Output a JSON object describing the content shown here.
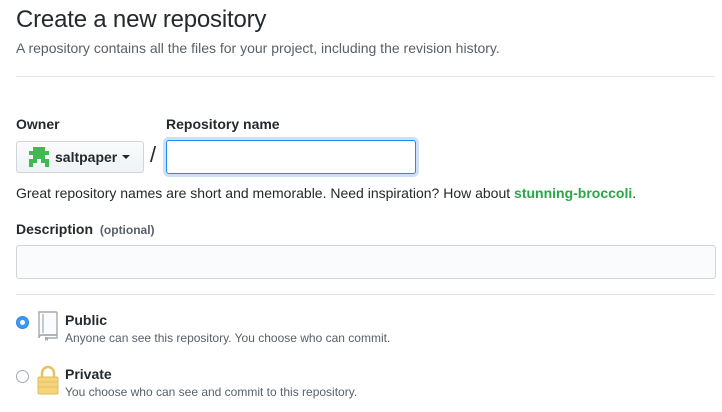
{
  "page": {
    "title": "Create a new repository",
    "subtitle": "A repository contains all the files for your project, including the revision history."
  },
  "owner": {
    "label": "Owner",
    "value": "saltpaper",
    "avatar_icon": "identicon-avatar",
    "avatar_color": "#3fb950"
  },
  "separator": "/",
  "repository_name": {
    "label": "Repository name",
    "value": "",
    "placeholder": ""
  },
  "hint": {
    "text": "Great repository names are short and memorable. Need inspiration? How about ",
    "suggestion": "stunning-broccoli",
    "end": "."
  },
  "description": {
    "label": "Description",
    "optional": "(optional)",
    "value": "",
    "placeholder": ""
  },
  "visibility": {
    "selected": "public",
    "options": [
      {
        "id": "public",
        "icon": "repo-book-icon",
        "title": "Public",
        "description": "Anyone can see this repository. You choose who can commit."
      },
      {
        "id": "private",
        "icon": "lock-icon",
        "title": "Private",
        "description": "You choose who can see and commit to this repository."
      }
    ]
  },
  "colors": {
    "focus_border": "#2188ff",
    "suggestion_green": "#28a745",
    "radio_selected": "#3b99fc",
    "lock_gold": "#f4d47c"
  }
}
